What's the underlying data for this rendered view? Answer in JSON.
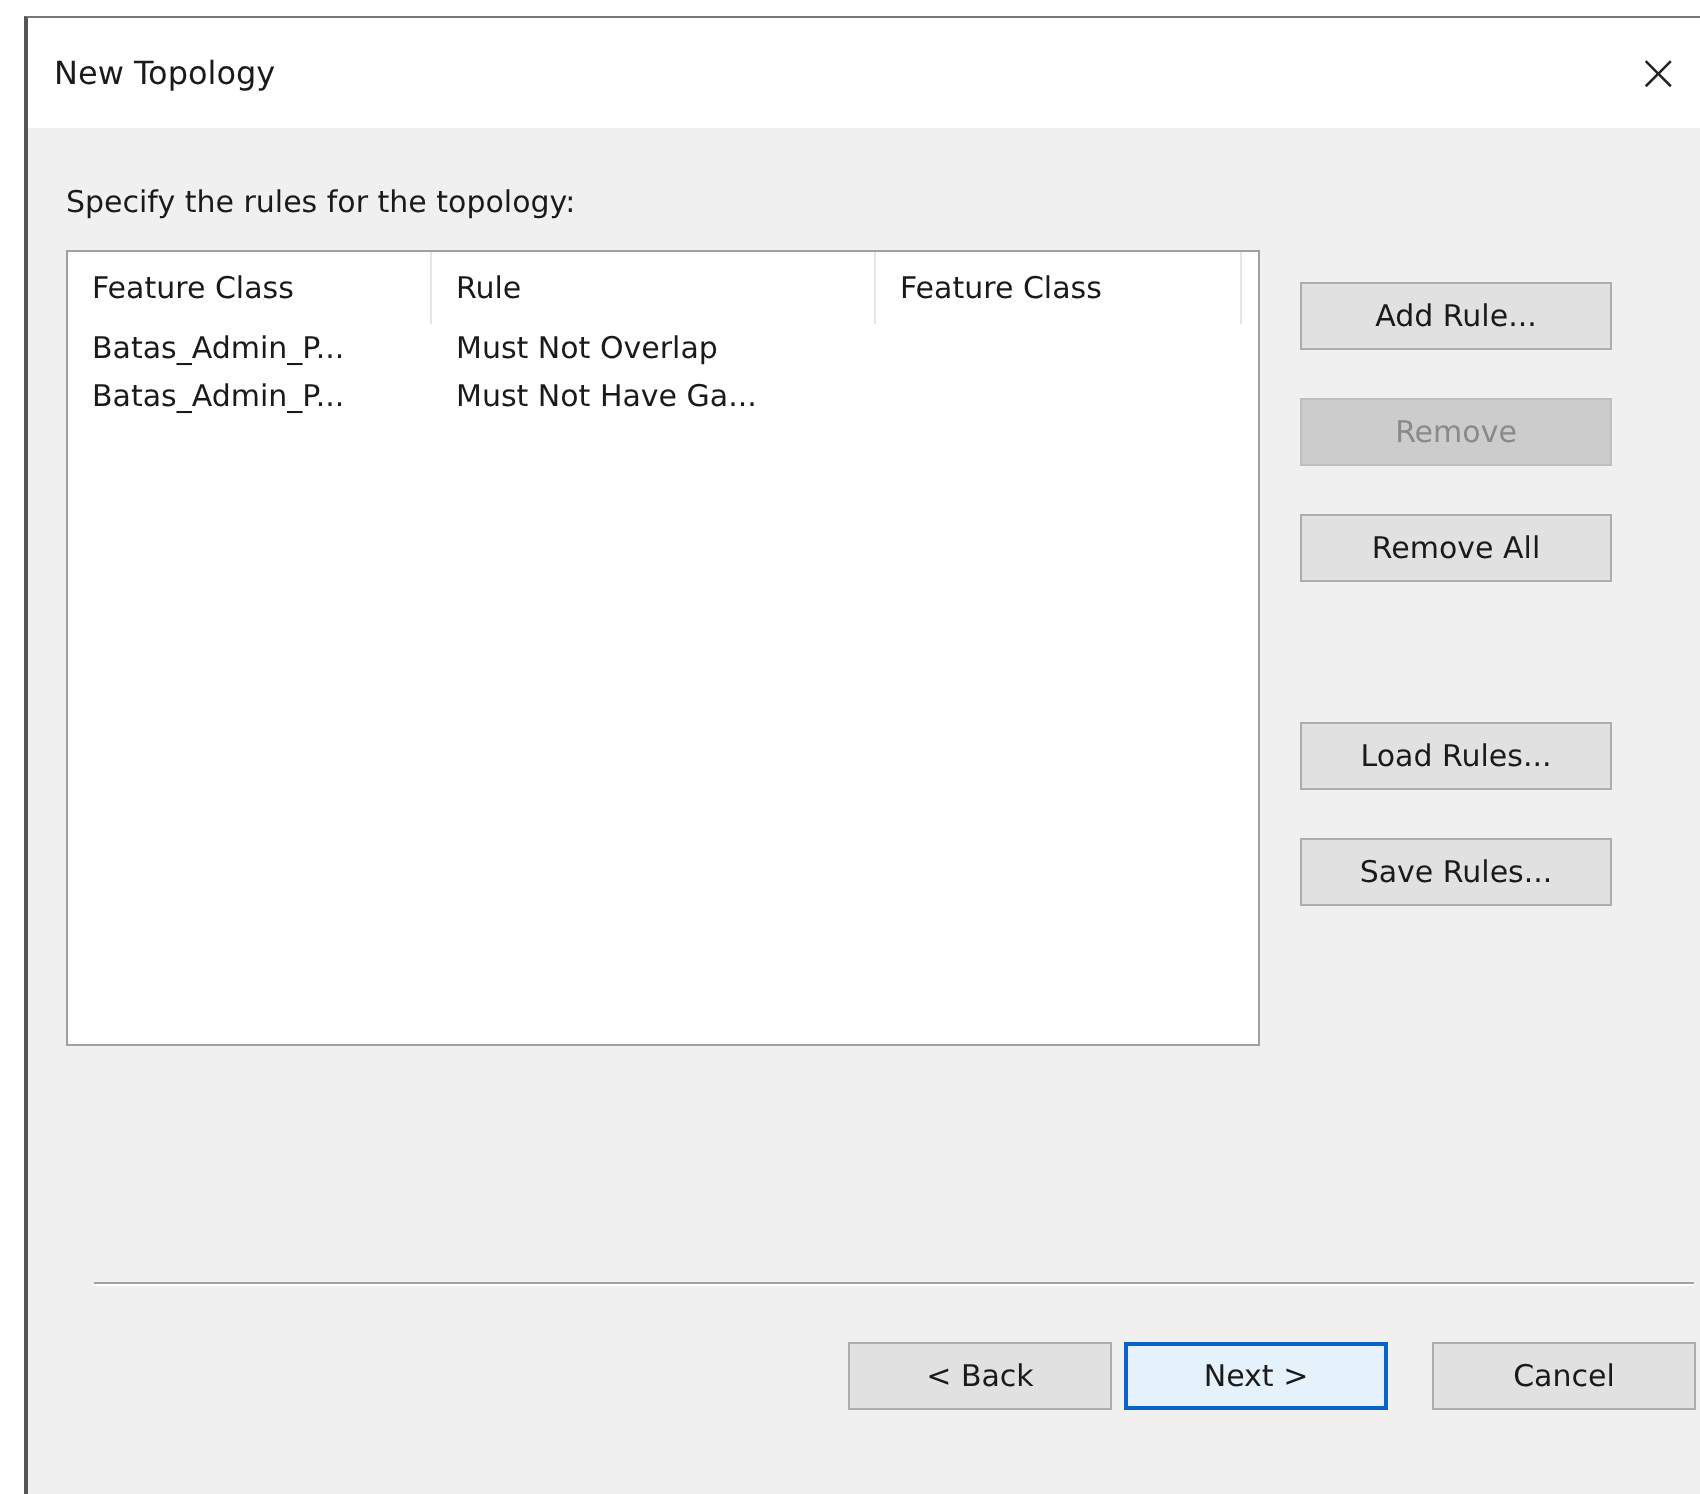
{
  "window": {
    "title": "New Topology",
    "close": "×"
  },
  "instruction": "Specify the rules for the topology:",
  "table": {
    "columns": [
      "Feature Class",
      "Rule",
      "Feature Class"
    ],
    "rows": [
      [
        "Batas_Admin_P...",
        "Must Not Overlap",
        ""
      ],
      [
        "Batas_Admin_P...",
        "Must Not Have Ga...",
        ""
      ]
    ]
  },
  "side_buttons": [
    {
      "label": "Add Rule...",
      "disabled": false,
      "gap_before": false
    },
    {
      "label": "Remove",
      "disabled": true,
      "gap_before": false
    },
    {
      "label": "Remove All",
      "disabled": false,
      "gap_before": false
    },
    {
      "label": "Load Rules...",
      "disabled": false,
      "gap_before": true
    },
    {
      "label": "Save Rules...",
      "disabled": false,
      "gap_before": false
    }
  ],
  "footer_buttons": [
    {
      "label": "< Back",
      "focused": false
    },
    {
      "label": "Next >",
      "focused": true
    },
    {
      "label": "Cancel",
      "focused": false
    }
  ]
}
